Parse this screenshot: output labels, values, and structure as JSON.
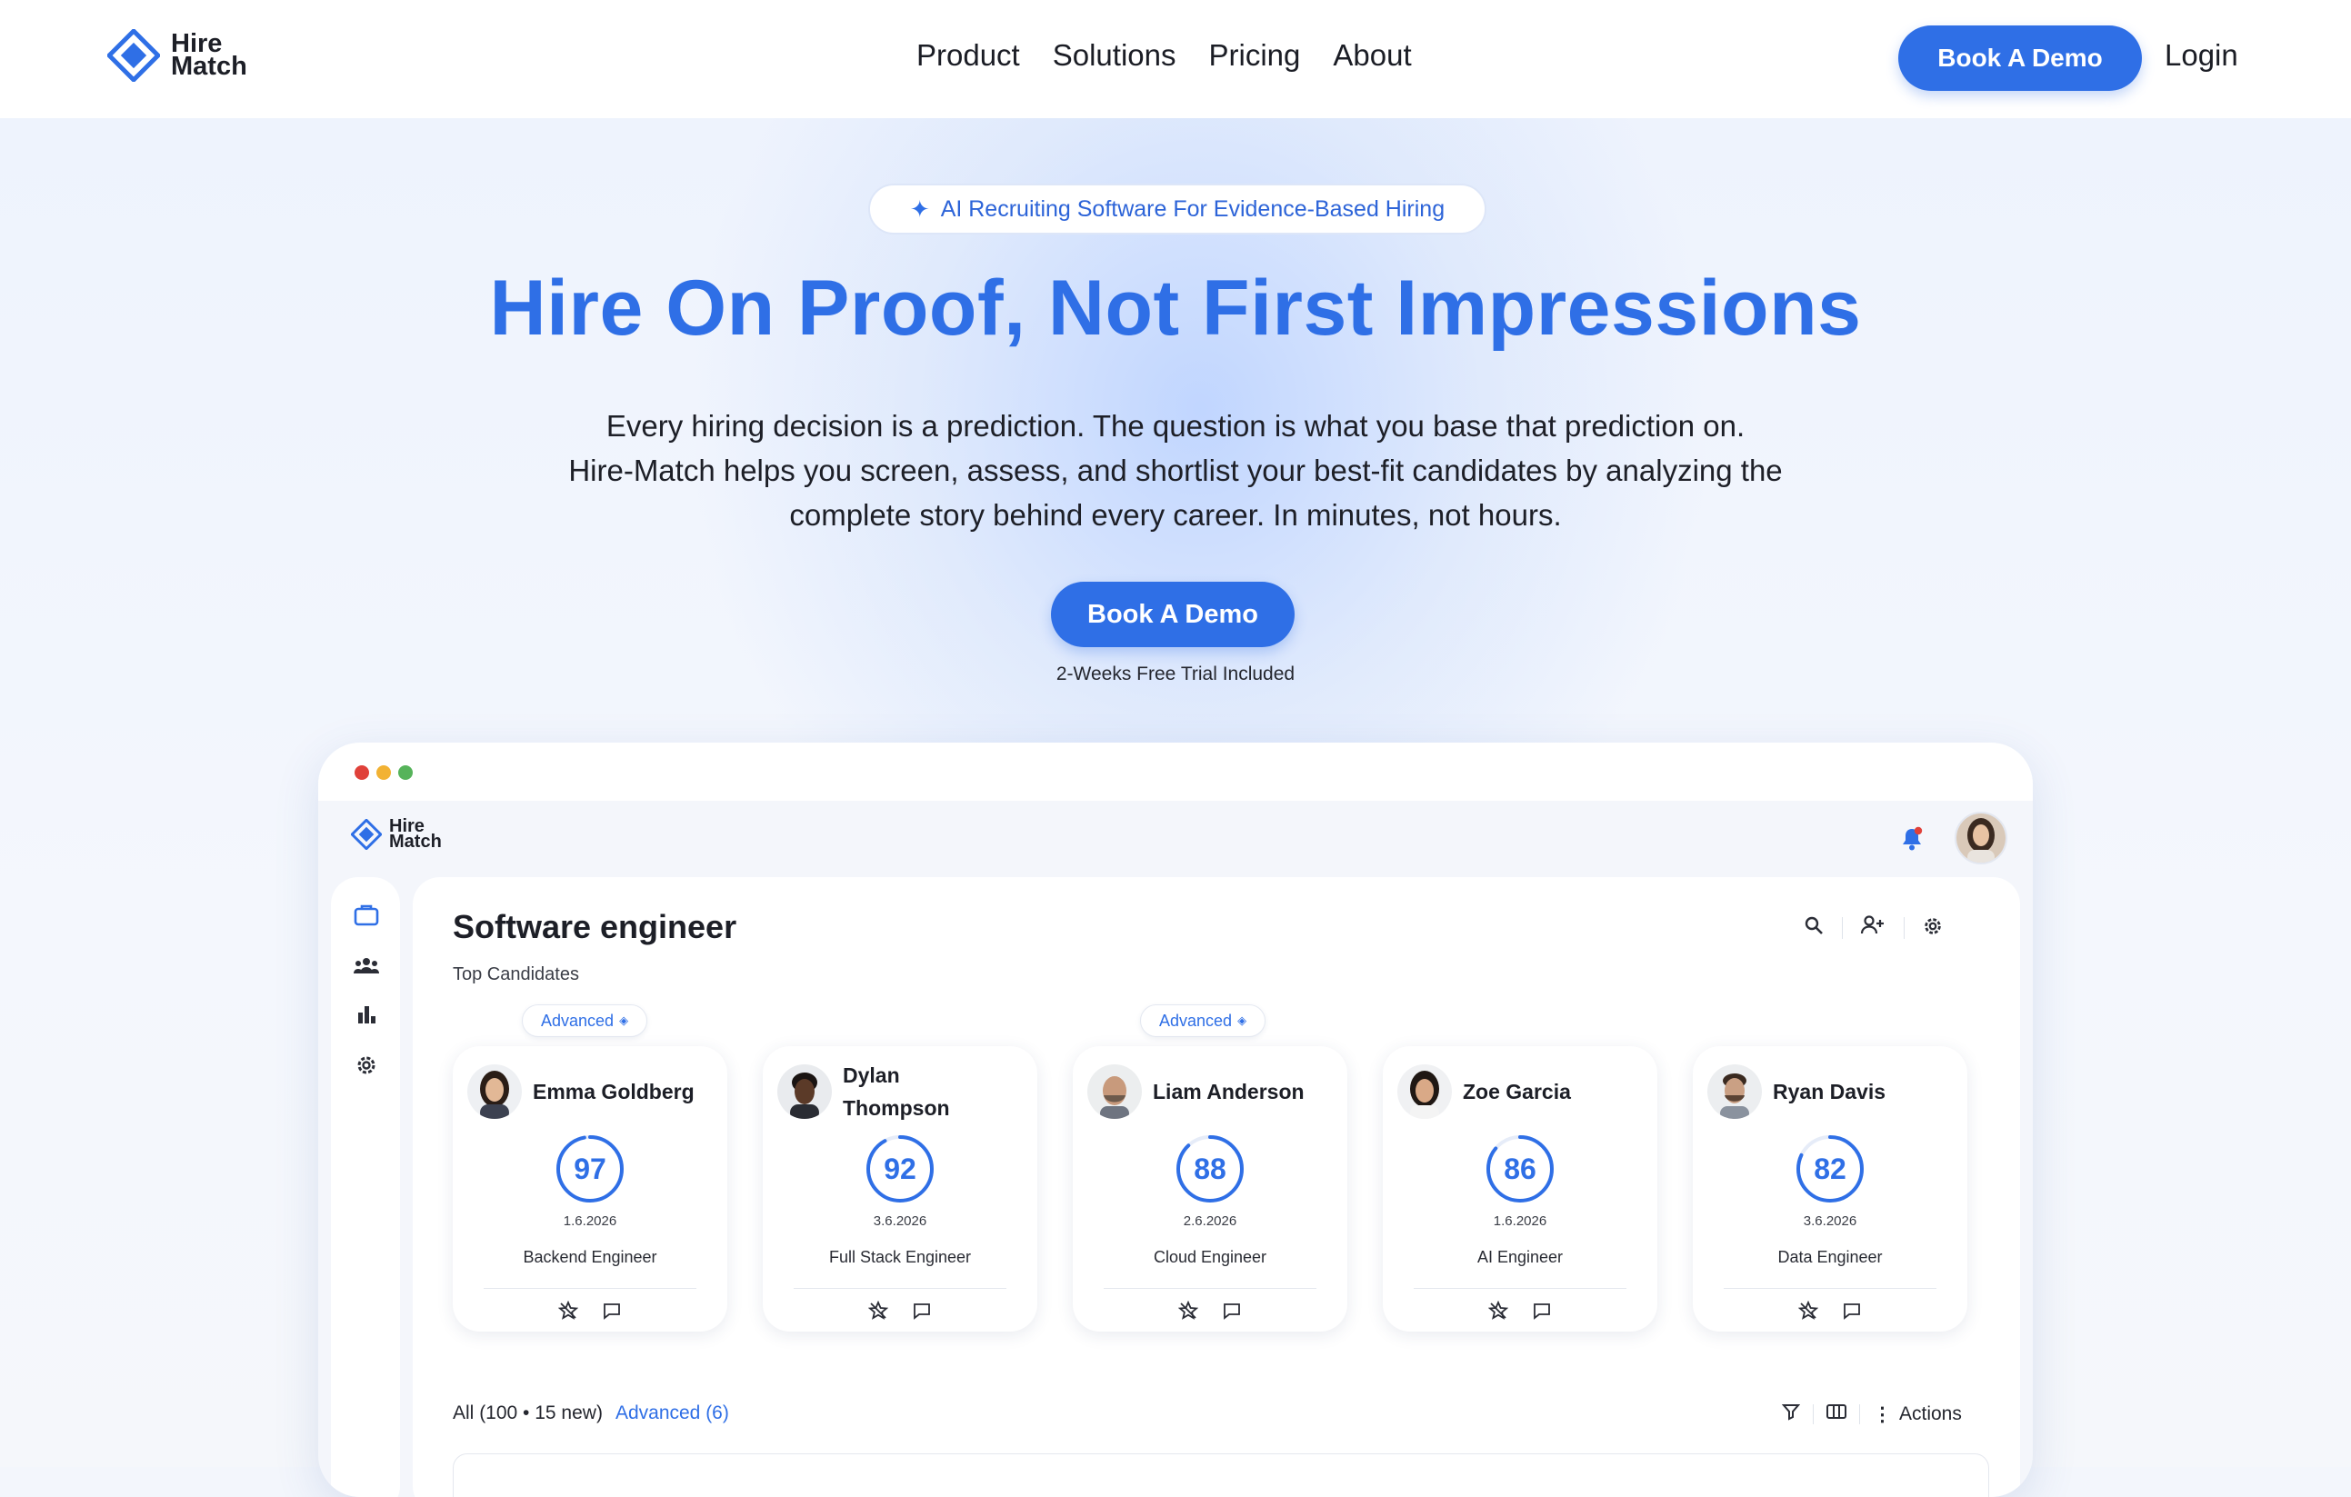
{
  "brand": {
    "name_line1": "Hire",
    "name_line2": "Match",
    "accent": "#2f6fe6"
  },
  "nav": {
    "links": [
      "Product",
      "Solutions",
      "Pricing",
      "About"
    ],
    "cta": "Book A Demo",
    "login": "Login"
  },
  "hero": {
    "badge": "AI Recruiting Software For Evidence-Based Hiring",
    "title": "Hire On Proof, Not First Impressions",
    "subtitle_lines": [
      "Every hiring decision is a prediction. The question is what you base that prediction on.",
      "Hire-Match helps you screen, assess, and shortlist your best-fit candidates by analyzing the",
      "complete story behind every career. In minutes, not hours."
    ],
    "cta": "Book A Demo",
    "cta_note": "2-Weeks Free Trial Included"
  },
  "app": {
    "window_dots": [
      "#e0413a",
      "#f2b233",
      "#56b35a"
    ],
    "logo_line1": "Hire",
    "logo_line2": "Match",
    "page_title": "Software engineer",
    "page_subtitle": "Top Candidates",
    "advanced_label": "Advanced",
    "candidates": [
      {
        "name": "Emma Goldberg",
        "score": 97,
        "date": "1.6.2026",
        "role": "Backend Engineer",
        "advanced": true
      },
      {
        "name": "Dylan Thompson",
        "score": 92,
        "date": "3.6.2026",
        "role": "Full Stack Engineer",
        "advanced": false
      },
      {
        "name": "Liam Anderson",
        "score": 88,
        "date": "2.6.2026",
        "role": "Cloud Engineer",
        "advanced": true
      },
      {
        "name": "Zoe Garcia",
        "score": 86,
        "date": "1.6.2026",
        "role": "AI Engineer",
        "advanced": false
      },
      {
        "name": "Ryan Davis",
        "score": 82,
        "date": "3.6.2026",
        "role": "Data Engineer",
        "advanced": false
      }
    ],
    "filters": {
      "all": "All",
      "all_count": "(100 • 15 new)",
      "advanced": "Advanced (6)"
    },
    "actions_label": "Actions",
    "icons": [
      "briefcase-icon",
      "team-icon",
      "bar-chart-icon",
      "gear-icon",
      "search-icon",
      "add-user-icon",
      "settings-icon",
      "bell-icon",
      "filter-icon",
      "columns-icon",
      "more-vertical-icon",
      "star-off-icon",
      "comment-icon"
    ]
  }
}
